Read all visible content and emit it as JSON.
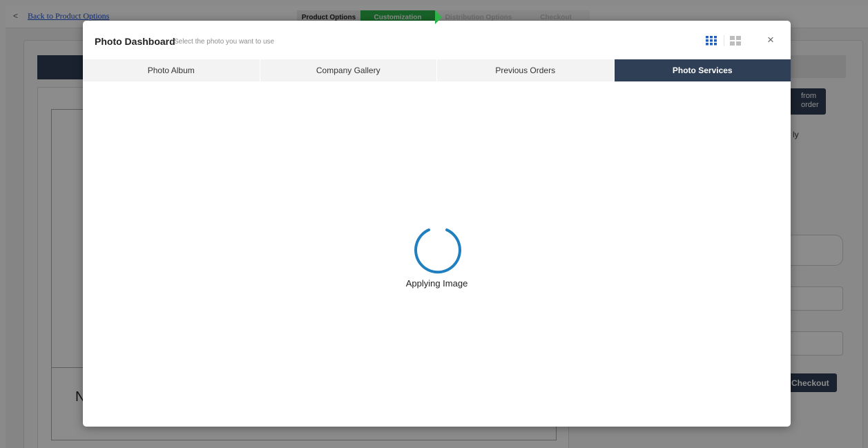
{
  "topnav": {
    "back_label": "Back to Product Options",
    "steps": [
      "Product Options",
      "Customization",
      "Distribution Options",
      "Checkout"
    ],
    "active_step": "Customization"
  },
  "background": {
    "from_order_label": "from\norder",
    "fragment_text": "ly",
    "left_letter": "N",
    "checkout_label": "Checkout"
  },
  "modal": {
    "title": "Photo Dashboard",
    "subtitle": "Select the photo you want to use",
    "view_icons": [
      "grid-view-icon",
      "large-grid-view-icon"
    ],
    "close_glyph": "×",
    "tabs": [
      "Photo Album",
      "Company Gallery",
      "Previous Orders",
      "Photo Services"
    ],
    "active_tab": "Photo Services",
    "loading_text": "Applying Image"
  },
  "colors": {
    "accent_dark": "#2f3f55",
    "step_active": "#2db34a",
    "spinner": "#1f7fbf",
    "grid_icon_active": "#1f5fbf",
    "grid_icon_inactive": "#bdbdbd"
  }
}
